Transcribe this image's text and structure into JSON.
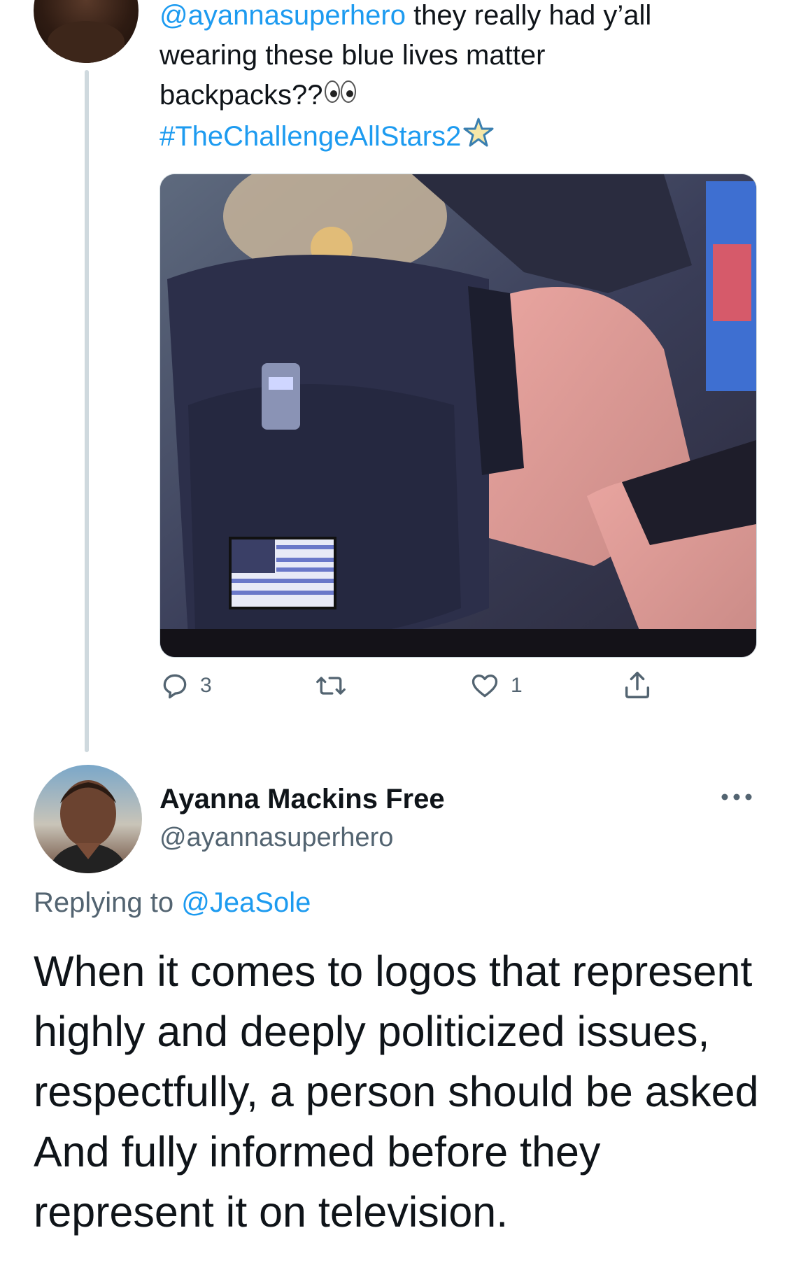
{
  "parent_tweet": {
    "mention": "@ayannasuperhero",
    "text_line1": " they really had y’all",
    "text_line2": "wearing these blue lives matter",
    "text_line3": "backpacks??",
    "hashtag": "#TheChallengeAllStars2",
    "emoji_icons": [
      "eyes-emoji",
      "star-emoji"
    ],
    "actions": {
      "reply_count": "3",
      "retweet_count": "",
      "like_count": "1"
    }
  },
  "reply_tweet": {
    "display_name": "Ayanna Mackins Free",
    "handle": "@ayannasuperhero",
    "replying_label": "Replying to ",
    "replying_to": "@JeaSole",
    "body": "When it comes to logos that represent highly and deeply politicized issues, respectfully, a person should be asked And fully informed before they represent it on television."
  },
  "colors": {
    "link": "#1d9bf0",
    "secondary_text": "#536471",
    "thread_line": "#cfd9de"
  }
}
